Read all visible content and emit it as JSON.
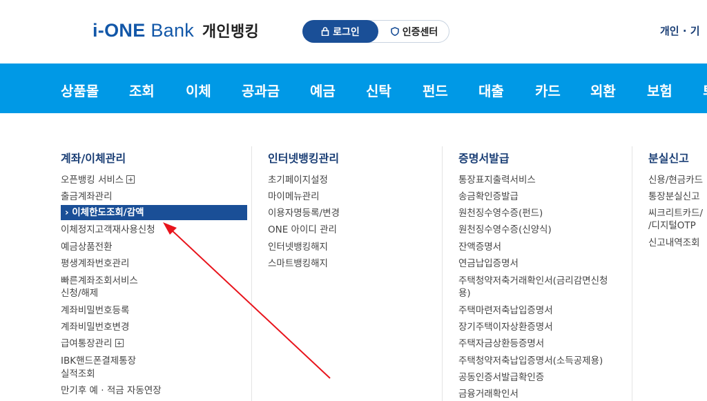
{
  "header": {
    "logo_brand": "i-ONE",
    "logo_bank": "Bank",
    "logo_sub": "개인뱅킹",
    "login_label": "로그인",
    "cert_label": "인증센터",
    "toplinks": "개인 · 기"
  },
  "nav": [
    "상품몰",
    "조회",
    "이체",
    "공과금",
    "예금",
    "신탁",
    "펀드",
    "대출",
    "카드",
    "외환",
    "보험",
    "퇴"
  ],
  "columns": [
    {
      "title": "계좌/이체관리",
      "items": [
        "오픈뱅킹 서비스",
        "출금계좌관리",
        "이체한도조회/감액",
        "이체정지고객재사용신청",
        "예금상품전환",
        "평생계좌번호관리",
        "빠른계좌조회서비스",
        "신청/해제",
        "계좌비밀번호등록",
        "계좌비밀번호변경",
        "급여통장관리",
        "IBK핸드폰결제통장",
        "실적조회",
        "만기후 예 · 적금 자동연장"
      ]
    },
    {
      "title": "인터넷뱅킹관리",
      "items": [
        "초기페이지설정",
        "마이메뉴관리",
        "이용자명등록/변경",
        "ONE 아이디 관리",
        "인터넷뱅킹해지",
        "스마트뱅킹해지"
      ]
    },
    {
      "title": "증명서발급",
      "items": [
        "통장표지출력서비스",
        "송금확인증발급",
        "원천징수영수증(펀드)",
        "원천징수영수증(신양식)",
        "잔액증명서",
        "연금납입증명서",
        "주택청약저축거래확인서(금리감면신청",
        "용)",
        "주택마련저축납입증명서",
        "장기주택이자상환증명서",
        "주택자금상환등증명서",
        "주택청약저축납입증명서(소득공제용)",
        "공동인증서발급확인증",
        "금융거래확인서"
      ]
    },
    {
      "title": "분실신고",
      "items": [
        "신용/현금카드",
        "통장분실신고",
        "씨크리트카드/",
        "/디지털OTP",
        "신고내역조회"
      ]
    }
  ],
  "colors": {
    "nav_bg": "#0099e6",
    "active_bg": "#1a4f97",
    "arrow": "#e8141c",
    "brand": "#1257a8"
  }
}
